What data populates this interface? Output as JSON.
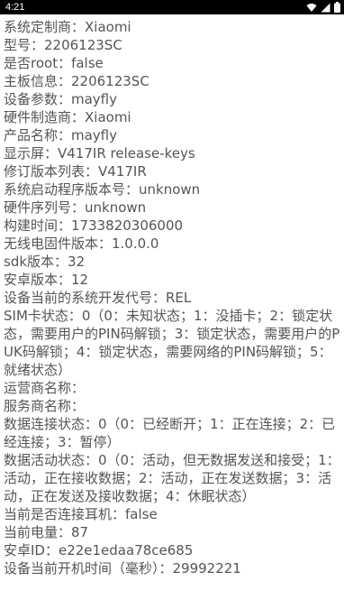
{
  "status_bar": {
    "time": "4:21",
    "icons": [
      "wifi-icon",
      "signal-icon",
      "battery-icon"
    ]
  },
  "device_info": {
    "lines": [
      "系统定制商：Xiaomi",
      "型号：2206123SC",
      "是否root：false",
      "主板信息：2206123SC",
      "设备参数：mayfly",
      "硬件制造商：Xiaomi",
      "产品名称：mayfly",
      "显示屏：V417IR release-keys",
      "修订版本列表：V417IR",
      "系统启动程序版本号：unknown",
      "硬件序列号：unknown",
      "构建时间：1733820306000",
      "无线电固件版本：1.0.0.0",
      "sdk版本：32",
      "安卓版本：12",
      "设备当前的系统开发代号：REL",
      "SIM卡状态：0（0：未知状态；1：没插卡；2：锁定状态，需要用户的PIN码解锁；3：锁定状态，需要用户的PUK码解锁；4：锁定状态，需要网络的PIN码解锁；5：就绪状态）",
      "运营商名称：",
      "服务商名称：",
      "数据连接状态：0（0：已经断开；1：正在连接；2：已经连接；3：暂停）",
      "数据活动状态：0（0：活动，但无数据发送和接受；1：活动，正在接收数据；2：活动，正在发送数据；3：活动，正在发送及接收数据；4：休眠状态）",
      "当前是否连接耳机：false",
      "当前电量：87",
      "安卓ID：e22e1edaa78ce685",
      "设备当前开机时间（毫秒）：29992221"
    ]
  }
}
